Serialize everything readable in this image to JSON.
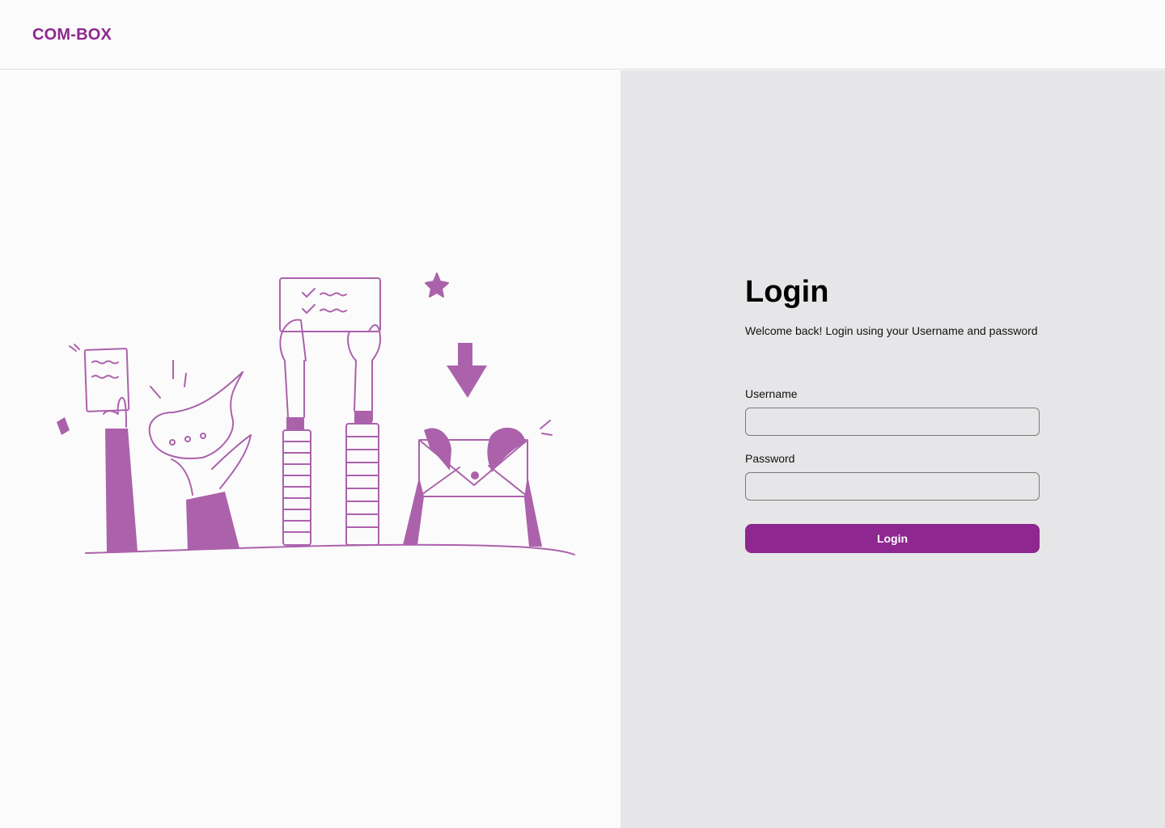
{
  "header": {
    "logo_text": "COM-BOX"
  },
  "login": {
    "title": "Login",
    "subtitle": "Welcome back! Login using your Username and password",
    "username_label": "Username",
    "username_value": "",
    "password_label": "Password",
    "password_value": "",
    "submit_label": "Login"
  },
  "colors": {
    "brand": "#8e278f",
    "illustration": "#ab62ab",
    "left_background": "#fbfbfb",
    "right_background": "#e6e6e8"
  },
  "illustration": {
    "icon": "hands-holding-messages-illustration"
  }
}
